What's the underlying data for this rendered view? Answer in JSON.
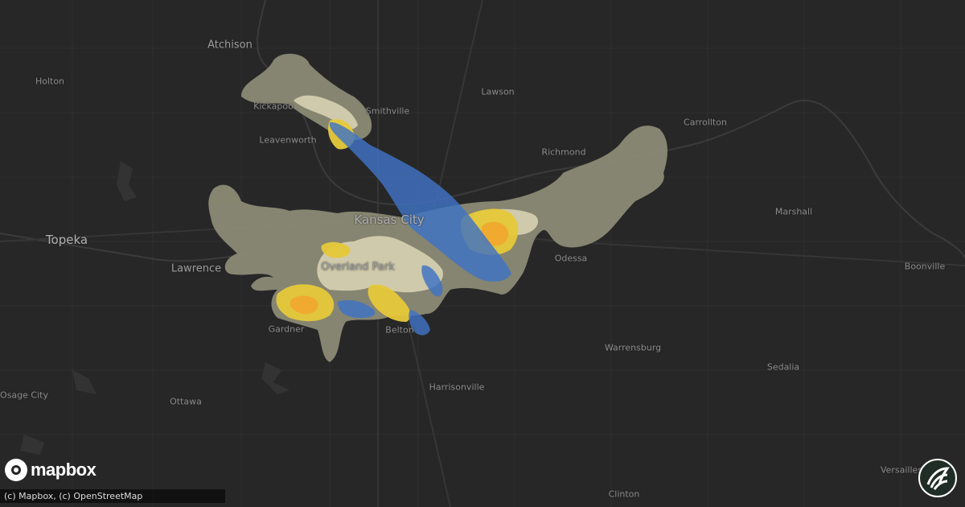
{
  "map": {
    "attribution": "(c) Mapbox, (c) OpenStreetMap",
    "logo_text": "mapbox",
    "colors": {
      "background": "#272727",
      "road": "#333333",
      "river": "#3a3a3a",
      "swath_gray": "#8e8d77",
      "swath_light": "#d8d2b2",
      "swath_yellow": "#e6c93a",
      "swath_orange": "#f0a92e",
      "swath_blue": "#3f73c4"
    },
    "cities": [
      {
        "name": "Atchison"
      },
      {
        "name": "Holton"
      },
      {
        "name": "Kickapoo"
      },
      {
        "name": "Smithville"
      },
      {
        "name": "Lawson"
      },
      {
        "name": "Leavenworth"
      },
      {
        "name": "Carrollton"
      },
      {
        "name": "Richmond"
      },
      {
        "name": "Kansas City"
      },
      {
        "name": "Marshall"
      },
      {
        "name": "Topeka"
      },
      {
        "name": "Lawrence"
      },
      {
        "name": "Overland Park"
      },
      {
        "name": "Odessa"
      },
      {
        "name": "Boonville"
      },
      {
        "name": "Gardner"
      },
      {
        "name": "Belton"
      },
      {
        "name": "Warrensburg"
      },
      {
        "name": "Sedalia"
      },
      {
        "name": "Harrisonville"
      },
      {
        "name": "Osage City"
      },
      {
        "name": "Ottawa"
      },
      {
        "name": "Versailles"
      },
      {
        "name": "Clinton"
      }
    ]
  }
}
